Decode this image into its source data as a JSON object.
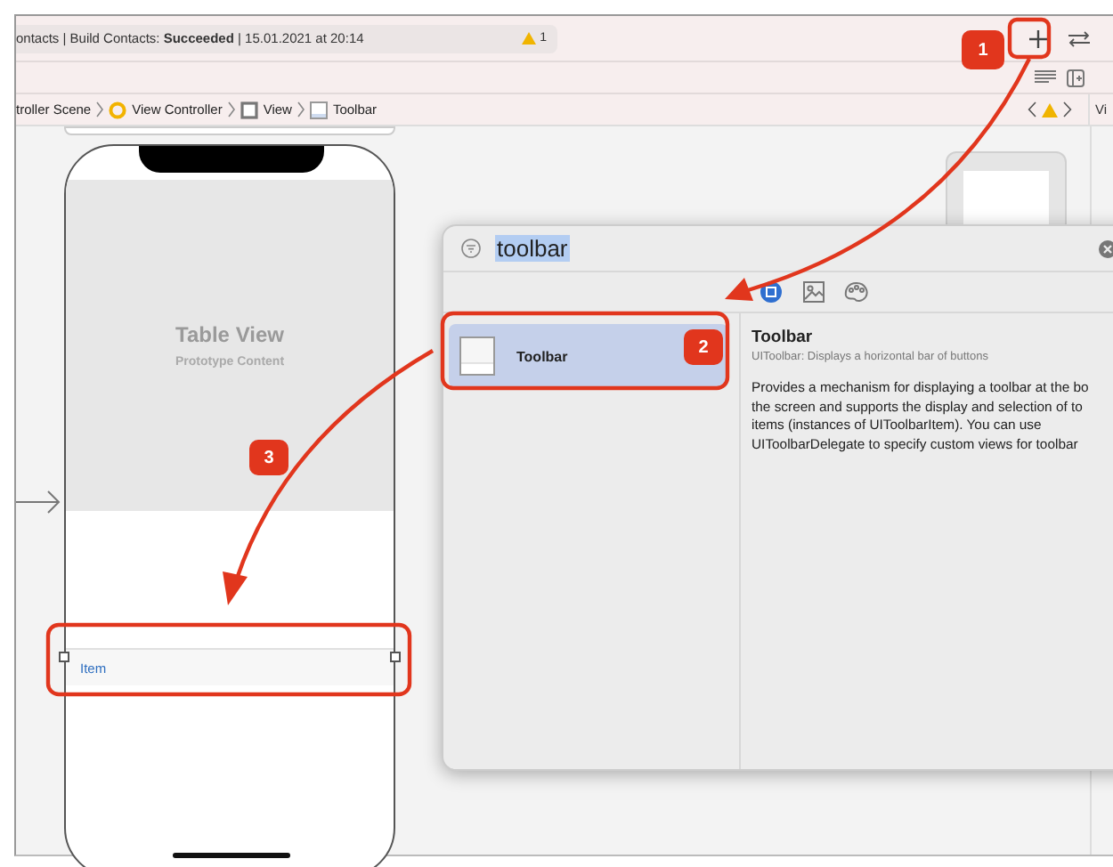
{
  "activity": {
    "text": "ontacts | Build Contacts: **Succeeded** | 15.01.2021 at 20:14",
    "warnings": "1"
  },
  "breadcrumb": [
    {
      "kind": "scene",
      "label": "troller Scene"
    },
    {
      "kind": "controller",
      "label": "View Controller"
    },
    {
      "kind": "view",
      "label": "View"
    },
    {
      "kind": "toolbar",
      "label": "Toolbar"
    }
  ],
  "inspector_tab": "Vi",
  "storyboard": {
    "table_title": "Table View",
    "table_subtitle": "Prototype Content",
    "toolbar_item": "Item"
  },
  "library": {
    "search": "toolbar",
    "tabs": [
      {
        "kind": "objects",
        "selected": true
      },
      {
        "kind": "images",
        "selected": false
      },
      {
        "kind": "colors",
        "selected": false
      }
    ],
    "items": [
      {
        "label": "Toolbar",
        "selected": true
      }
    ],
    "detail": {
      "title": "Toolbar",
      "subtitle": "UIToolbar: Displays a horizontal bar of buttons",
      "lines": [
        "Provides a mechanism for displaying a toolbar at the bo",
        "the screen and supports the display and selection of to",
        "items (instances of UIToolbarItem). You can use",
        "UIToolbarDelegate to specify custom views for toolbar"
      ]
    }
  },
  "callouts": [
    {
      "number": "1"
    },
    {
      "number": "2"
    },
    {
      "number": "3"
    }
  ]
}
